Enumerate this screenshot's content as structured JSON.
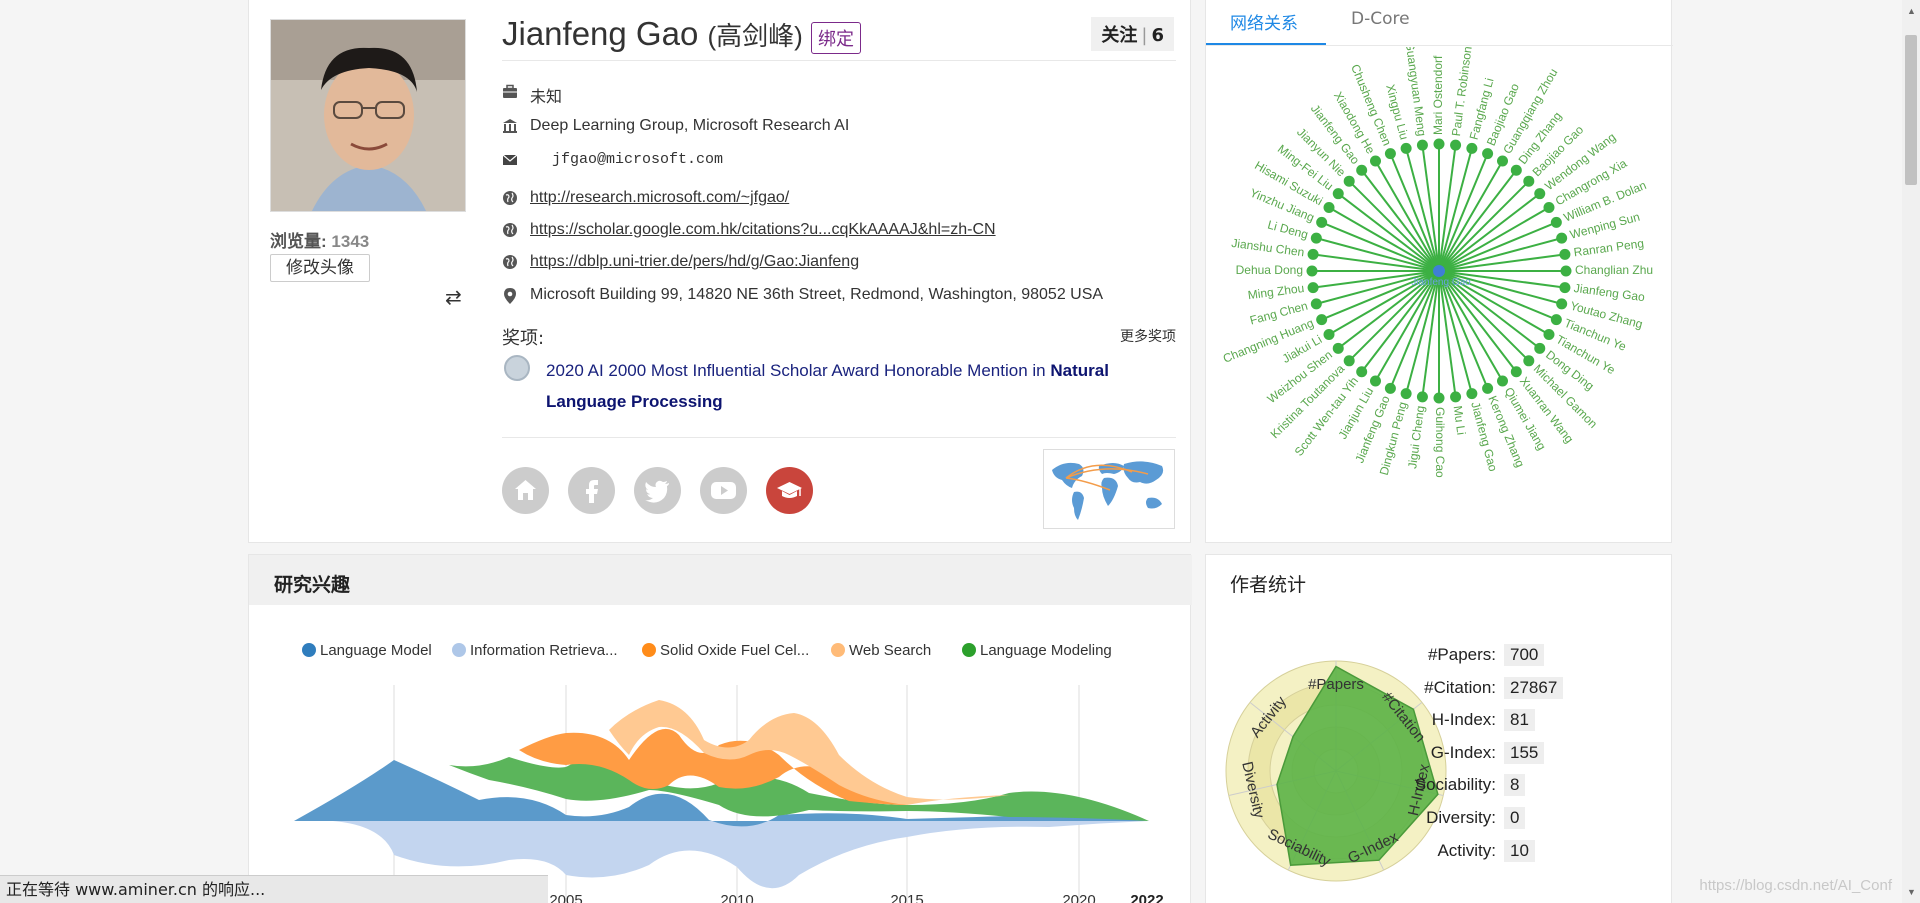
{
  "profile": {
    "name_en": "Jianfeng Gao",
    "name_cn": "(高剑峰)",
    "bind_label": "绑定",
    "follow_label": "关注",
    "follow_count": "6",
    "views_label": "浏览量:",
    "views_count": "1343",
    "change_avatar_label": "修改头像",
    "position": "未知",
    "affiliation": "Deep Learning Group, Microsoft Research AI",
    "email": "jfgao@microsoft.com",
    "homepage": "http://research.microsoft.com/~jfgao/",
    "scholar": "https://scholar.google.com.hk/citations?u...cqKkAAAAJ&hl=zh-CN",
    "dblp": "https://dblp.uni-trier.de/pers/hd/g/Gao:Jianfeng",
    "address": "Microsoft Building 99, 14820 NE 36th Street, Redmond, Washington, 98052 USA",
    "awards_label": "奖项:",
    "more_awards_label": "更多奖项",
    "award_text_prefix": "2020 AI 2000 Most Influential Scholar Award Honorable Mention in ",
    "award_text_bold": "Natural Language Processing",
    "social_icons": [
      "home-icon",
      "facebook-icon",
      "twitter-icon",
      "youtube-icon",
      "scholar-cap-icon"
    ]
  },
  "network": {
    "tabs": [
      "网络关系",
      "D-Core"
    ],
    "center_label": "Jianfeng Gao",
    "node_color": "#3cb043",
    "center_color": "#3f7fd6",
    "coauthors": [
      "Mari Ostendorf",
      "Paul T. Robinson",
      "Fangfang Li",
      "Baojiao Gao",
      "Guangqiang Zhou",
      "Ding Zhang",
      "Baojiao Gao",
      "Wendong Wang",
      "Changrong Xia",
      "William B. Dolan",
      "Wenping Sun",
      "Ranran Peng",
      "Changlian Zhu",
      "Jianfeng Gao",
      "Youtao Zhang",
      "Tianchun Ye",
      "Tianchun Ye",
      "Dong Ding",
      "Michael Gamon",
      "Xuanran Wang",
      "Qiumei Jiang",
      "Kerong Zhang",
      "Jianfeng Gao",
      "Mu Li",
      "Guihong Cao",
      "Jigui Cheng",
      "Dingkun Peng",
      "Jianfeng Gao",
      "Jianjun Liu",
      "Scott Wen-tau Yih",
      "Kristina Toutanova",
      "Weizhou Shen",
      "Jiakui Li",
      "Changning Huang",
      "Fang Chen",
      "Ming Zhou",
      "Dehua Dong",
      "Jianshu Chen",
      "Li Deng",
      "Yinzhu Jiang",
      "Hisami Suzuki",
      "Ming-Fei Liu",
      "Jianyun Nie",
      "Jianfeng Gao",
      "Xiaodong He",
      "Chusheng Chen",
      "Xingpu Liu",
      "Guangyuan Meng"
    ]
  },
  "research": {
    "title": "研究兴趣",
    "legend": [
      {
        "name": "Language Model",
        "color": "#2f7dbd"
      },
      {
        "name": "Information Retrieva...",
        "color": "#aec7e8"
      },
      {
        "name": "Solid Oxide Fuel Cel...",
        "color": "#ff8c1a"
      },
      {
        "name": "Web Search",
        "color": "#ffbb78"
      },
      {
        "name": "Language Modeling",
        "color": "#2ca02c"
      }
    ],
    "x_ticks": [
      "2005",
      "2010",
      "2015",
      "2020"
    ],
    "x_end": "2022"
  },
  "stats": {
    "title": "作者统计",
    "rows": [
      {
        "label": "#Papers:",
        "value": "700"
      },
      {
        "label": "#Citation:",
        "value": "27867"
      },
      {
        "label": "H-Index:",
        "value": "81"
      },
      {
        "label": "G-Index:",
        "value": "155"
      },
      {
        "label": "Sociability:",
        "value": "8"
      },
      {
        "label": "Diversity:",
        "value": "0"
      },
      {
        "label": "Activity:",
        "value": "10"
      }
    ],
    "radar_axes": [
      "#Papers",
      "#Citation",
      "H-Index",
      "G-Index",
      "Sociability",
      "Diversity",
      "Activity"
    ],
    "radar_color": "#5cb247"
  },
  "status_text": "正在等待 www.aminer.cn 的响应...",
  "watermark": "https://blog.csdn.net/AI_Conf"
}
